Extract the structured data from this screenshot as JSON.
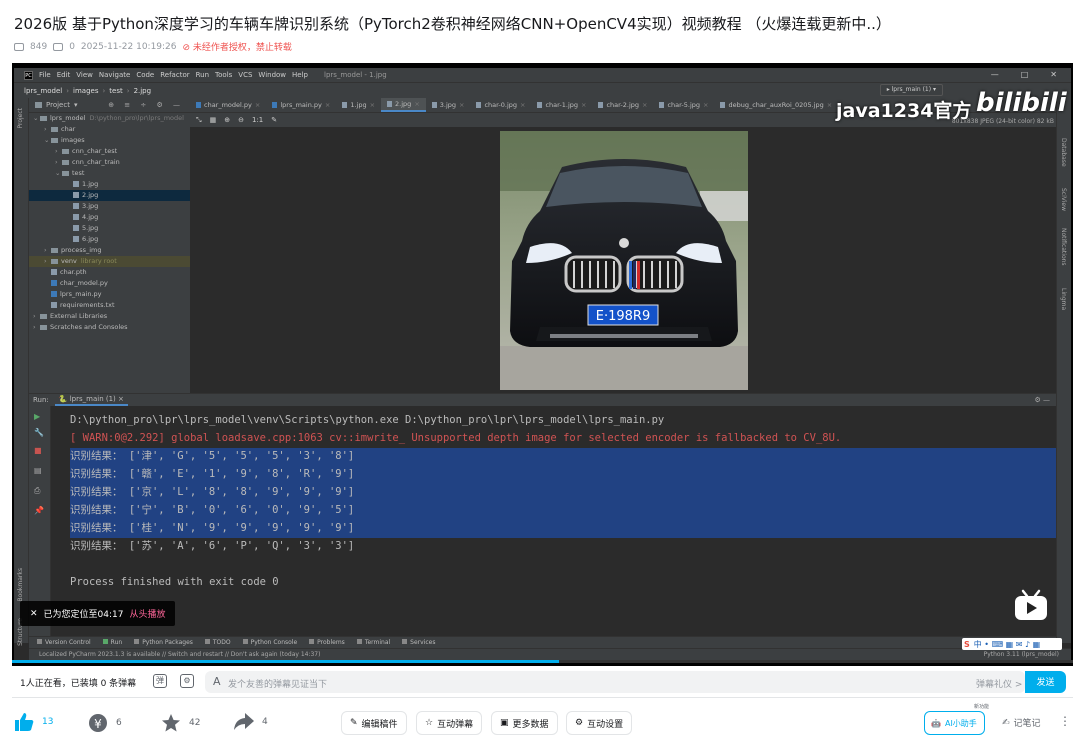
{
  "video": {
    "title": "2026版 基于Python深度学习的车辆车牌识别系统（PyTorch2卷积神经网络CNN+OpenCV4实现）视频教程 （火爆连载更新中..）",
    "plays": "849",
    "danmaku_count": "0",
    "date": "2025-11-22 10:19:26",
    "copyright": "未经作者授权，禁止转载"
  },
  "ide": {
    "menu": [
      "File",
      "Edit",
      "View",
      "Navigate",
      "Code",
      "Refactor",
      "Run",
      "Tools",
      "VCS",
      "Window",
      "Help"
    ],
    "window_title": "lprs_model - 1.jpg",
    "breadcrumb": [
      "lprs_model",
      "images",
      "test",
      "2.jpg"
    ],
    "run_config": "lprs_main (1)",
    "project_label": "Project",
    "tree": [
      {
        "label": "lprs_model",
        "extra": "D:\\python_pro\\lpr\\lprs_model",
        "level": 0,
        "kind": "folder",
        "open": true
      },
      {
        "label": "char",
        "level": 1,
        "kind": "folder"
      },
      {
        "label": "images",
        "level": 1,
        "kind": "folder",
        "open": true
      },
      {
        "label": "cnn_char_test",
        "level": 2,
        "kind": "folder"
      },
      {
        "label": "cnn_char_train",
        "level": 2,
        "kind": "folder"
      },
      {
        "label": "test",
        "level": 2,
        "kind": "folder",
        "open": true
      },
      {
        "label": "1.jpg",
        "level": 3,
        "kind": "img"
      },
      {
        "label": "2.jpg",
        "level": 3,
        "kind": "img",
        "selected": true
      },
      {
        "label": "3.jpg",
        "level": 3,
        "kind": "img"
      },
      {
        "label": "4.jpg",
        "level": 3,
        "kind": "img"
      },
      {
        "label": "5.jpg",
        "level": 3,
        "kind": "img"
      },
      {
        "label": "6.jpg",
        "level": 3,
        "kind": "img"
      },
      {
        "label": "process_img",
        "level": 1,
        "kind": "folder"
      },
      {
        "label": "venv",
        "extra": "library root",
        "level": 1,
        "kind": "folder",
        "highlight": true
      },
      {
        "label": "char.pth",
        "level": 1,
        "kind": "file"
      },
      {
        "label": "char_model.py",
        "level": 1,
        "kind": "py"
      },
      {
        "label": "lprs_main.py",
        "level": 1,
        "kind": "py"
      },
      {
        "label": "requirements.txt",
        "level": 1,
        "kind": "file"
      },
      {
        "label": "External Libraries",
        "level": 0,
        "kind": "folder"
      },
      {
        "label": "Scratches and Consoles",
        "level": 0,
        "kind": "folder"
      }
    ],
    "tabs": [
      {
        "label": "char_model.py",
        "kind": "py"
      },
      {
        "label": "lprs_main.py",
        "kind": "py"
      },
      {
        "label": "1.jpg",
        "kind": "img"
      },
      {
        "label": "2.jpg",
        "kind": "img",
        "active": true
      },
      {
        "label": "3.jpg",
        "kind": "img"
      },
      {
        "label": "char-0.jpg",
        "kind": "img"
      },
      {
        "label": "char-1.jpg",
        "kind": "img"
      },
      {
        "label": "char-2.jpg",
        "kind": "img"
      },
      {
        "label": "char-5.jpg",
        "kind": "img"
      },
      {
        "label": "debug_char_auxRoi_0205.jpg",
        "kind": "img"
      }
    ],
    "image_info": "801x838 JPEG (24-bit color) 82 kB",
    "zoom_label": "1:1",
    "plate_text": "E·198R9",
    "run_tab_prefix": "Run:",
    "run_tab": "lprs_main (1)",
    "console": [
      {
        "text": "D:\\python_pro\\lpr\\lprs_model\\venv\\Scripts\\python.exe D:\\python_pro\\lpr\\lprs_model\\lprs_main.py",
        "type": "normal"
      },
      {
        "text": "[ WARN:0@2.292] global loadsave.cpp:1063 cv::imwrite_ Unsupported depth image for selected encoder is fallbacked to CV_8U.",
        "type": "error"
      },
      {
        "text": "识别结果： ['津', 'G', '5', '5', '5', '3', '8']",
        "type": "selected"
      },
      {
        "text": "识别结果： ['赣', 'E', '1', '9', '8', 'R', '9']",
        "type": "selected"
      },
      {
        "text": "识别结果： ['京', 'L', '8', '8', '9', '9', '9']",
        "type": "selected"
      },
      {
        "text": "识别结果： ['宁', 'B', '0', '6', '0', '9', '5']",
        "type": "selected"
      },
      {
        "text": "识别结果： ['桂', 'N', '9', '9', '9', '9', '9']",
        "type": "selected"
      },
      {
        "text": "识别结果： ['苏', 'A', '6', 'P', 'Q', '3', '3']",
        "type": "normal"
      },
      {
        "text": "",
        "type": "normal"
      },
      {
        "text": "Process finished with exit code 0",
        "type": "normal"
      }
    ],
    "bottom_tabs": [
      "Version Control",
      "Run",
      "Python Packages",
      "TODO",
      "Python Console",
      "Problems",
      "Terminal",
      "Services"
    ],
    "status": "Localized PyCharm 2023.1.3 is available // Switch and restart // Don't ask again (today 14:37)",
    "status_right": "Python 3.11 (lprs_model)",
    "left_strip": [
      "Project",
      "Bookmarks",
      "Structure"
    ],
    "right_strip": [
      "Database",
      "SciView",
      "Notifications",
      "Lingma"
    ]
  },
  "overlay": {
    "watermark": "java1234官方",
    "bili_logo": "bilibili",
    "toast_text": "已为您定位至04:17",
    "toast_action": "从头播放",
    "progress": 0.516
  },
  "danmaku_bar": {
    "watching": "1人正在看，已装填 0 条弹幕",
    "placeholder": "发个友善的弹幕见证当下",
    "etiquette": "弹幕礼仪 >",
    "send": "发送"
  },
  "actions": {
    "like": "13",
    "coin": "6",
    "fav": "42",
    "share": "4",
    "edit": "编辑稿件",
    "interact_danmaku": "互动弹幕",
    "more_data": "更多数据",
    "interact_settings": "互动设置",
    "ai_helper": "AI小助手",
    "ai_badge": "新功能",
    "notes": "记笔记",
    "more": "⋮"
  },
  "colors": {
    "accent": "#00aeec",
    "selection": "#214283",
    "warn": "#d05353",
    "ide_bg": "#2b2b2b",
    "panel": "#3c3f41"
  }
}
